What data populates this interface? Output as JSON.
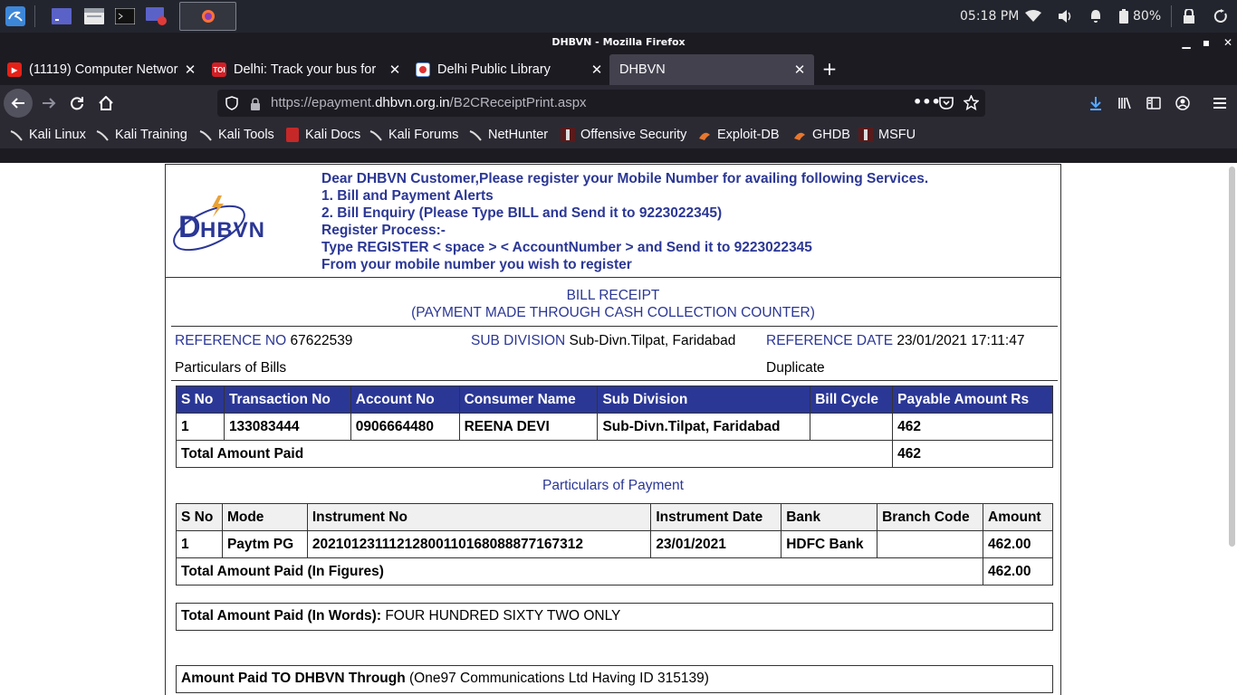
{
  "taskbar": {
    "clock": "05:18 PM",
    "battery": "80%"
  },
  "window": {
    "title": "DHBVN - Mozilla Firefox"
  },
  "tabs": [
    {
      "label": "(11119) Computer Networ",
      "favicon": "youtube-icon"
    },
    {
      "label": "Delhi: Track your bus for",
      "favicon": "toi-icon",
      "favicon_text": "TOI"
    },
    {
      "label": "Delhi Public Library",
      "favicon": "library-icon"
    },
    {
      "label": "DHBVN",
      "favicon": "none",
      "active": true
    }
  ],
  "urlbar": {
    "prefix": "https://epayment.",
    "host": "dhbvn.org.in",
    "path": "/B2CReceiptPrint.aspx"
  },
  "bookmarks": [
    "Kali Linux",
    "Kali Training",
    "Kali Tools",
    "Kali Docs",
    "Kali Forums",
    "NetHunter",
    "Offensive Security",
    "Exploit-DB",
    "GHDB",
    "MSFU"
  ],
  "logo": {
    "text": "DHBVN",
    "brand_color": "#2b3795",
    "bolt_color": "#e8a33a"
  },
  "notice": [
    "Dear DHBVN Customer,Please register your Mobile Number for availing following Services.",
    "1. Bill and Payment Alerts",
    "2. Bill Enquiry (Please Type BILL and Send it to 9223022345)",
    "Register Process:-",
    "Type REGISTER < space > < AccountNumber > and Send it to 9223022345",
    "From your mobile number you wish to register"
  ],
  "receipt": {
    "title": "BILL RECEIPT",
    "subtitle": "(PAYMENT MADE THROUGH CASH COLLECTION COUNTER)",
    "reference_no_label": "REFERENCE NO",
    "reference_no": "67622539",
    "sub_division_label": "SUB DIVISION",
    "sub_division": "Sub-Divn.Tilpat, Faridabad",
    "reference_date_label": "REFERENCE DATE",
    "reference_date": "23/01/2021 17:11:47",
    "particulars_bills_label": "Particulars of Bills",
    "duplicate_label": "Duplicate",
    "bills": {
      "headers": [
        "S No",
        "Transaction No",
        "Account No",
        "Consumer Name",
        "Sub Division",
        "Bill Cycle",
        "Payable Amount Rs"
      ],
      "row": [
        "1",
        "133083444",
        "0906664480",
        "REENA DEVI",
        "Sub-Divn.Tilpat, Faridabad",
        "",
        "462"
      ],
      "total_label": "Total Amount Paid",
      "total_value": "462"
    },
    "particulars_payment_label": "Particulars of Payment",
    "payment": {
      "headers": [
        "S No",
        "Mode",
        "Instrument No",
        "Instrument Date",
        "Bank",
        "Branch Code",
        "Amount"
      ],
      "row": [
        "1",
        "Paytm PG",
        "20210123111212800110168088877167312",
        "23/01/2021",
        "HDFC Bank",
        "",
        "462.00"
      ],
      "total_label": "Total Amount Paid (In Figures)",
      "total_value": "462.00"
    },
    "words_label": "Total Amount Paid (In Words):",
    "words_value": "FOUR HUNDRED SIXTY TWO ONLY",
    "through_label": "Amount Paid TO DHBVN Through",
    "through_value": "(One97 Communications Ltd Having ID 315139)"
  }
}
